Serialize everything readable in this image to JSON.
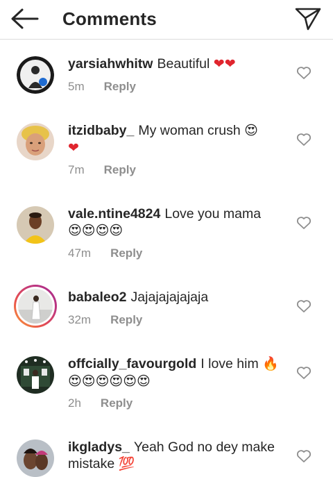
{
  "header": {
    "title": "Comments",
    "back_icon": "arrow-left-icon",
    "share_icon": "paper-plane-icon"
  },
  "reply_label": "Reply",
  "colors": {
    "text": "#262626",
    "secondary": "#8e8e8e",
    "divider": "#dbdbdb",
    "heart_emoji": "#e0252e",
    "story_ring": "#e9524c"
  },
  "comments": [
    {
      "username": "yarsiahwhitw",
      "text": "Beautiful",
      "emoji": "❤❤",
      "time": "5m"
    },
    {
      "username": "itzidbaby_",
      "text": "My woman crush",
      "emoji": "😍",
      "emoji2": "❤",
      "time": "7m"
    },
    {
      "username": "vale.ntine4824",
      "text": "Love you mama",
      "emoji2": "😍😍😍😍",
      "time": "47m"
    },
    {
      "username": "babaleo2",
      "text": "Jajajajajajaja",
      "time": "32m"
    },
    {
      "username": "offcially_favourgold",
      "text": "I love him",
      "emoji": "🔥",
      "emoji2": "😍😍😍😍😍😍",
      "time": "2h"
    },
    {
      "username": "ikgladys_",
      "text": "Yeah God no dey make",
      "text2": "mistake",
      "emoji": "💯"
    }
  ]
}
